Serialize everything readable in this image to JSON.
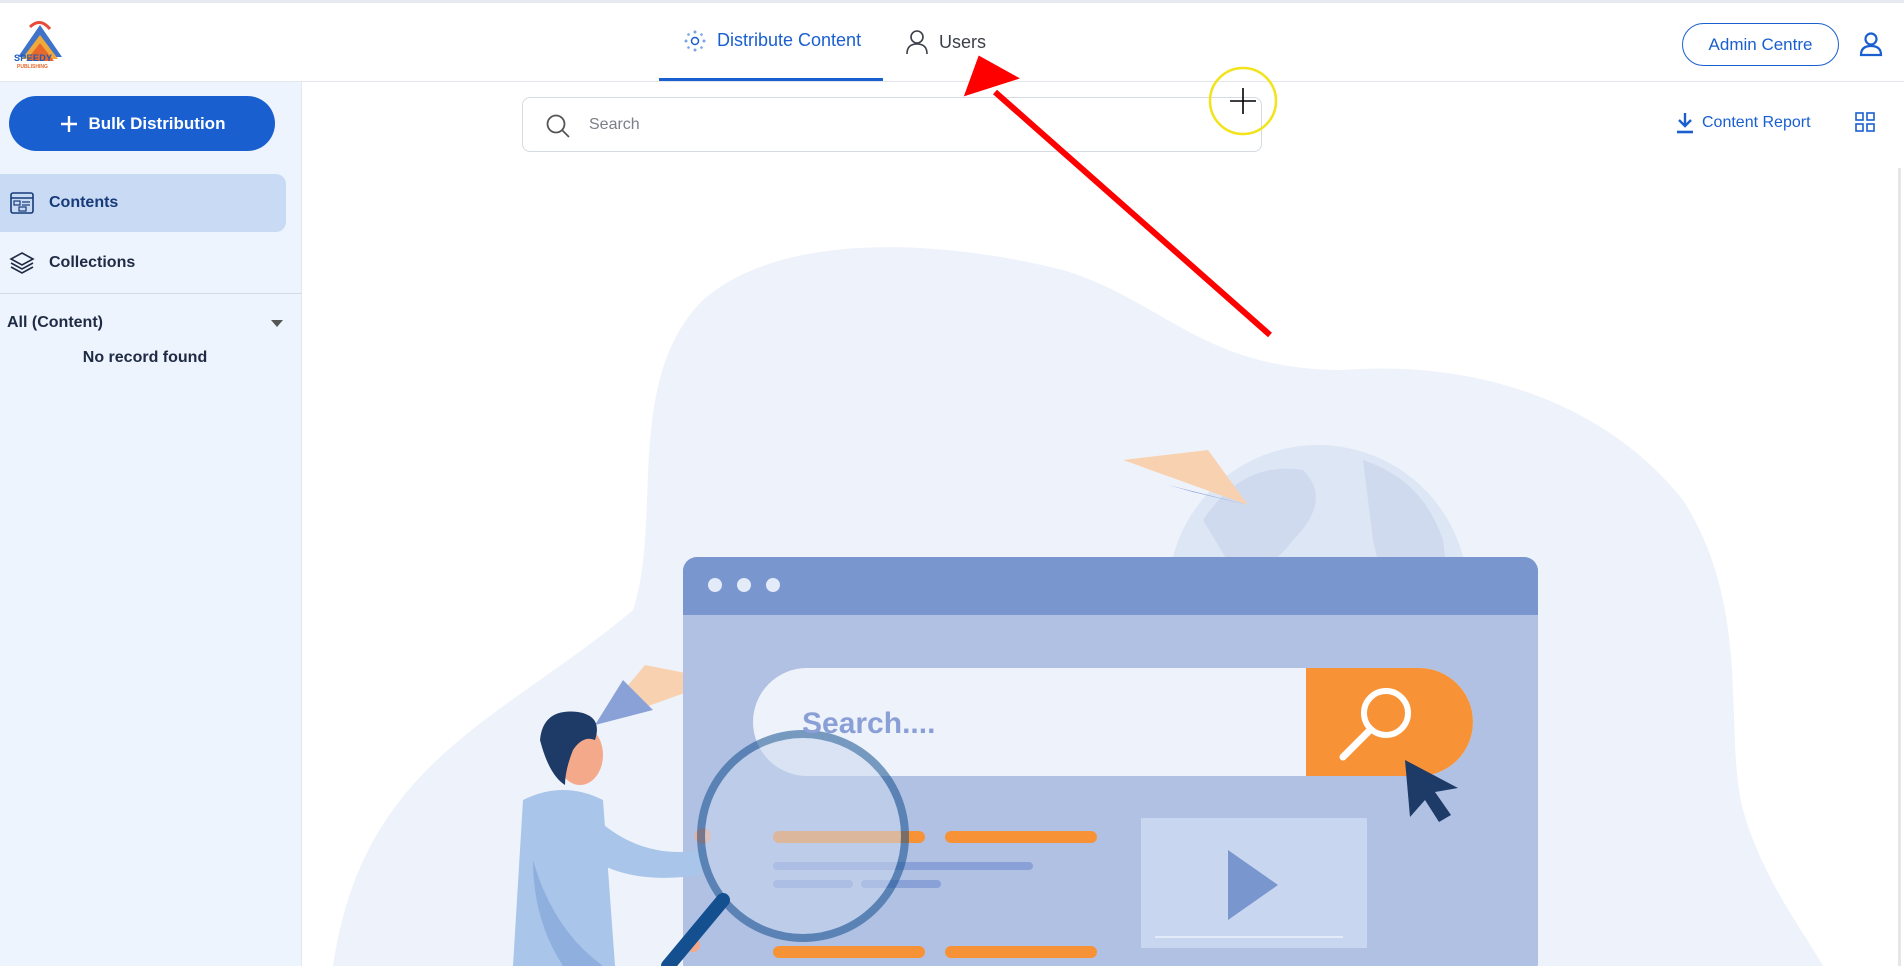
{
  "brand": {
    "logo_text": "SPEEDY",
    "logo_subtext": "PUBLISHING"
  },
  "nav": {
    "tabs": [
      {
        "label": "Distribute Content",
        "icon": "network-icon",
        "active": true
      },
      {
        "label": "Users",
        "icon": "user-icon",
        "active": false
      }
    ],
    "admin_label": "Admin Centre",
    "account_icon": "account-icon"
  },
  "sidebar": {
    "bulk_label": "Bulk Distribution",
    "items": [
      {
        "label": "Contents",
        "icon": "contents-icon",
        "active": true
      },
      {
        "label": "Collections",
        "icon": "layers-icon",
        "active": false
      }
    ],
    "filter_label": "All (Content)",
    "empty_text": "No record found"
  },
  "toolbar": {
    "search_placeholder": "Search",
    "report_label": "Content Report",
    "view_icon": "grid-view-icon"
  },
  "illustration": {
    "search_text": "Search...."
  },
  "colors": {
    "accent": "#1a5fd0",
    "sidebar_bg": "#edf4fd",
    "sidebar_active": "#c9dbf4",
    "annotation_arrow": "#ff0000",
    "cursor_ring": "#f2e31b",
    "illustration_orange": "#f79336"
  }
}
